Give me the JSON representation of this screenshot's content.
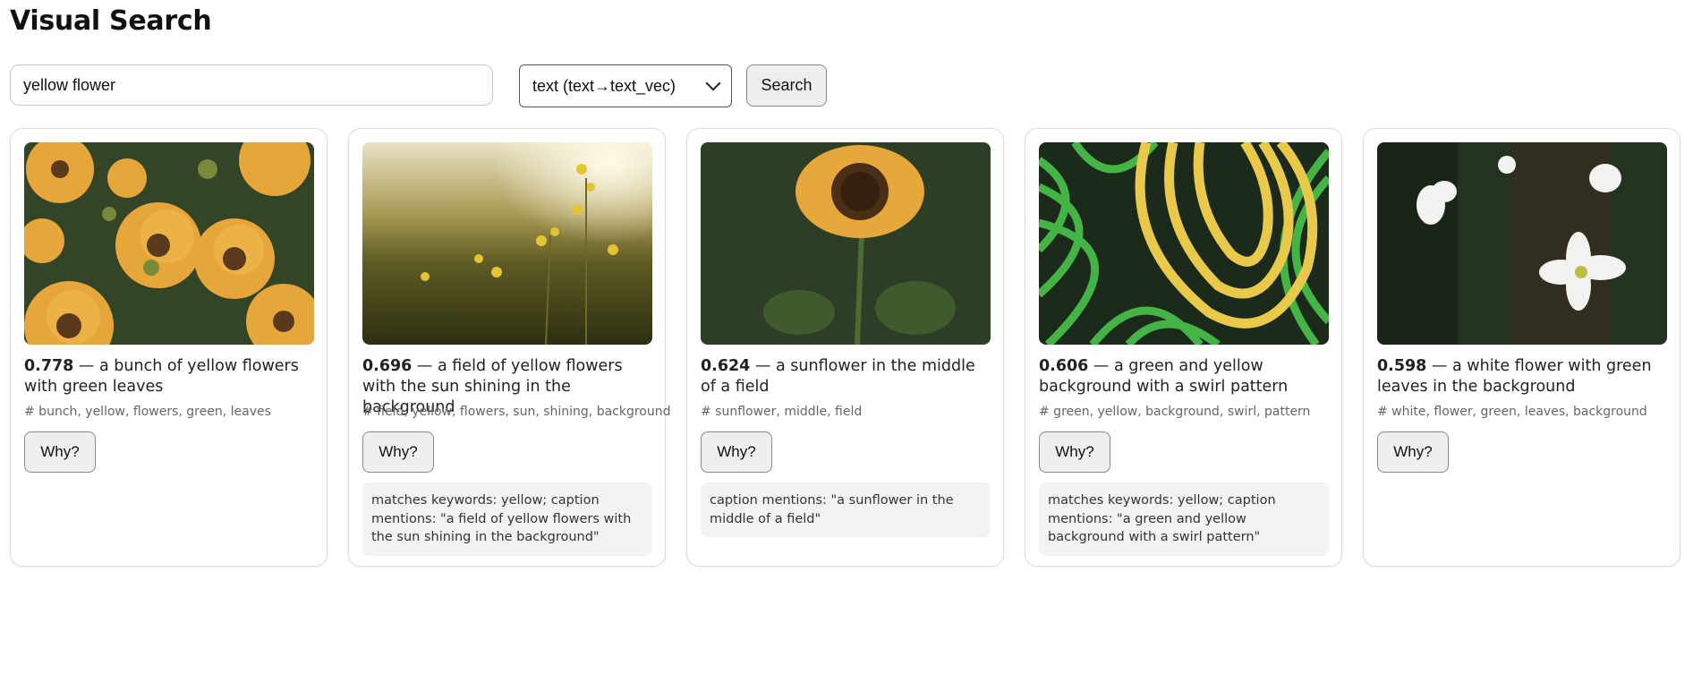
{
  "title": "Visual Search",
  "search": {
    "value": "yellow flower"
  },
  "mode_select": {
    "selected": "text (text→text_vec)"
  },
  "search_button": "Search",
  "results": [
    {
      "score": "0.778",
      "caption": "a bunch of yellow flowers with green leaves",
      "tags": "# bunch, yellow, flowers, green, leaves",
      "why_label": "Why?",
      "why_text": ""
    },
    {
      "score": "0.696",
      "caption": "a field of yellow flowers with the sun shining in the background",
      "tags": "# field, yellow, flowers, sun, shining, background",
      "why_label": "Why?",
      "why_text": "matches keywords: yellow; caption mentions: \"a field of yellow flowers with the sun shining in the background\""
    },
    {
      "score": "0.624",
      "caption": "a sunflower in the middle of a field",
      "tags": "# sunflower, middle, field",
      "why_label": "Why?",
      "why_text": "caption mentions: \"a sunflower in the middle of a field\""
    },
    {
      "score": "0.606",
      "caption": "a green and yellow background with a swirl pattern",
      "tags": "# green, yellow, background, swirl, pattern",
      "why_label": "Why?",
      "why_text": "matches keywords: yellow; caption mentions: \"a green and yellow background with a swirl pattern\""
    },
    {
      "score": "0.598",
      "caption": "a white flower with green leaves in the background",
      "tags": "# white, flower, green, leaves, background",
      "why_label": "Why?",
      "why_text": ""
    }
  ]
}
